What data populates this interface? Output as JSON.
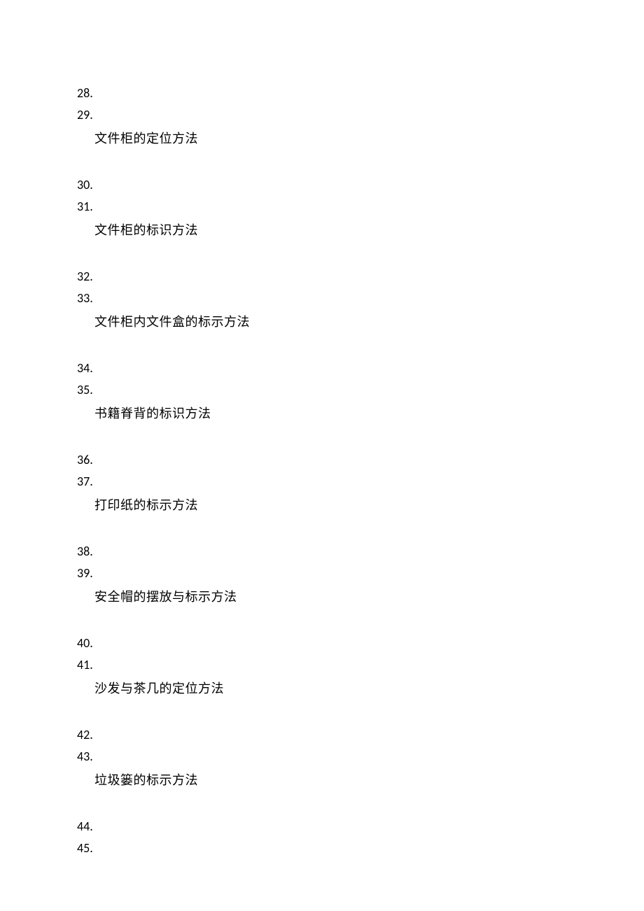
{
  "sections": [
    {
      "numbers": [
        "28.",
        "29."
      ],
      "description": "文件柜的定位方法"
    },
    {
      "numbers": [
        "30.",
        "31."
      ],
      "description": "文件柜的标识方法"
    },
    {
      "numbers": [
        "32.",
        "33."
      ],
      "description": "文件柜内文件盒的标示方法"
    },
    {
      "numbers": [
        "34.",
        "35."
      ],
      "description": "书籍脊背的标识方法"
    },
    {
      "numbers": [
        "36.",
        "37."
      ],
      "description": "打印纸的标示方法"
    },
    {
      "numbers": [
        "38.",
        "39."
      ],
      "description": "安全帽的摆放与标示方法"
    },
    {
      "numbers": [
        "40.",
        "41."
      ],
      "description": "沙发与茶几的定位方法"
    },
    {
      "numbers": [
        "42.",
        "43."
      ],
      "description": "垃圾篓的标示方法"
    },
    {
      "numbers": [
        "44.",
        "45."
      ],
      "description": ""
    }
  ]
}
